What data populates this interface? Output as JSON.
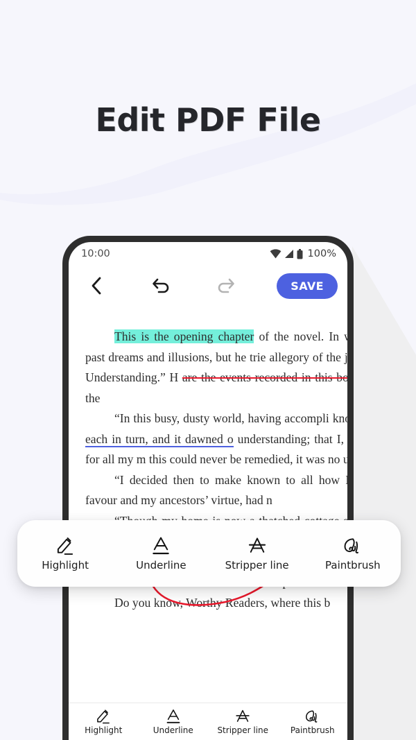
{
  "page": {
    "headline": "Edit PDF File",
    "background_color": "#f6f6fc",
    "accent_color": "#4d61e0",
    "highlight_color": "#74efdb",
    "strike_color": "#e8192c",
    "underline_color": "#4d61e0",
    "brush_color": "#e8192c",
    "bezel_color": "#2e2e2e"
  },
  "status_bar": {
    "time": "10:00",
    "battery_percent": "100%",
    "icons": [
      "wifi-icon",
      "signal-icon",
      "battery-icon"
    ]
  },
  "app_toolbar": {
    "back_label": "back-chevron-icon",
    "undo_label": "undo-icon",
    "redo_label": "redo-icon",
    "save_label": "SAVE"
  },
  "document": {
    "paragraphs": [
      {
        "id": "p1",
        "segments": [
          {
            "text": "This is the opening chapter",
            "style": "highlight"
          },
          {
            "text": " of the novel. In wr certain of his past dreams and illusions, but he trie allegory of the jade of “Spiritual Understanding.” H ",
            "style": "plain"
          },
          {
            "text": "are the events recorded in this book, and ",
            "style": "strikethrough"
          },
          {
            "text": "who are the",
            "style": "plain"
          }
        ]
      },
      {
        "id": "p2",
        "segments": [
          {
            "text": "“In this busy, dusty world, having accompli known, ",
            "style": "plain"
          },
          {
            "text": "considering each in turn, and it dawned o",
            "style": "underline"
          },
          {
            "text": " understanding; that I, shameful to say, for all my m this could never be remedied, it was no use regretting",
            "style": "plain"
          }
        ]
      },
      {
        "id": "p3",
        "segments": [
          {
            "text": "“I decided then to make known to all how I, t the Imperial favour and my ancestors’ virtue, had n",
            "style": "plain"
          }
        ]
      },
      {
        "id": "p4",
        "segments": [
          {
            "text": "“Though my home is now a thatched cottage shall not stop me from laying bare my heart. Indeed my steps and the flowers in my courtyard inspire m literary talent, what does it matter if I tell a tale in ru This should divert readers too and help distract them Yucun.”²",
            "style": "plain"
          }
        ]
      },
      {
        "id": "p5",
        "segments": [
          {
            "text": "Do you know, Worthy Readers, where this b",
            "style": "plain"
          }
        ]
      }
    ]
  },
  "tools": [
    {
      "label": "Highlight",
      "icon": "highlighter-pen-icon"
    },
    {
      "label": "Underline",
      "icon": "letter-a-underline-icon"
    },
    {
      "label": "Stripper line",
      "icon": "letter-a-strikethrough-icon"
    },
    {
      "label": "Paintbrush",
      "icon": "scribble-brush-icon"
    }
  ]
}
